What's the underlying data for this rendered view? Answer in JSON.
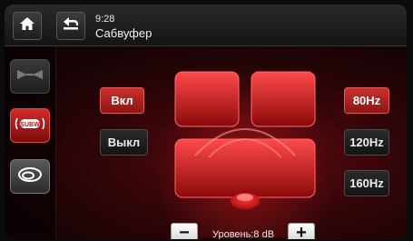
{
  "header": {
    "time": "9:28",
    "title": "Сабвуфер",
    "home_icon": "home-icon",
    "back_icon": "back-arrow-icon"
  },
  "sidebar": {
    "items": [
      {
        "icon": "balance-icon",
        "active": false
      },
      {
        "icon": "subwoofer-icon",
        "label": "SUBW",
        "active": true
      },
      {
        "icon": "surround-icon",
        "active": false
      }
    ]
  },
  "power": {
    "on_label": "Вкл",
    "off_label": "Выкл",
    "selected": "Вкл"
  },
  "crossover": {
    "options": [
      "80Hz",
      "120Hz",
      "160Hz"
    ],
    "selected": "80Hz"
  },
  "level": {
    "label": "Уровень:8 dB",
    "minus": "−",
    "plus": "+"
  },
  "colors": {
    "accent": "#c8312f",
    "background": "#1a0506"
  }
}
